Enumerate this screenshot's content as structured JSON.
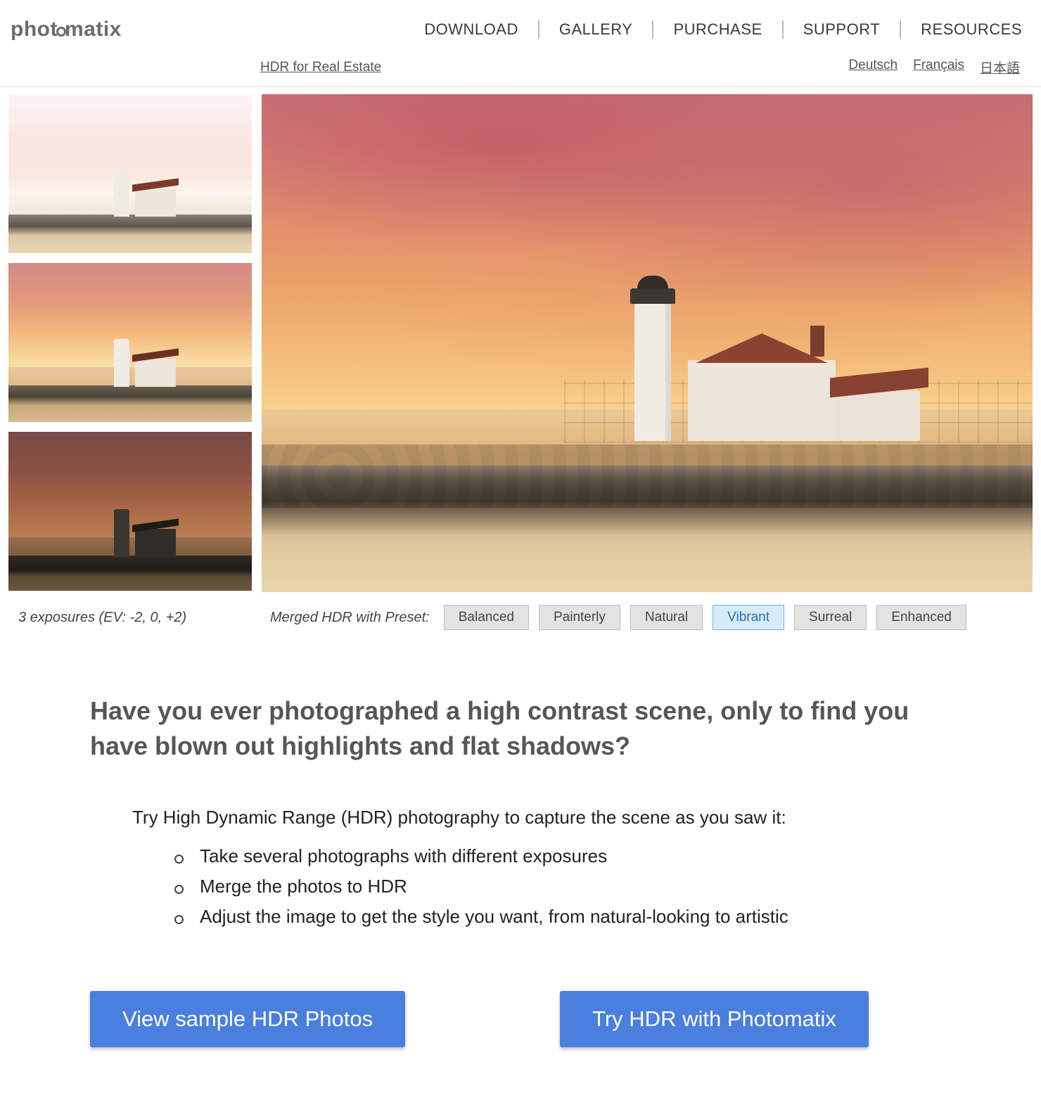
{
  "header": {
    "logo": {
      "pre": "phot",
      "post": "matix"
    },
    "nav": [
      "DOWNLOAD",
      "GALLERY",
      "PURCHASE",
      "SUPPORT",
      "RESOURCES"
    ]
  },
  "subheader": {
    "link": "HDR for Real Estate",
    "languages": [
      "Deutsch",
      "Français",
      "日本語"
    ]
  },
  "gallery": {
    "exposures_caption": "3 exposures (EV: -2, 0, +2)",
    "merged_caption": "Merged HDR with Preset:",
    "presets": [
      "Balanced",
      "Painterly",
      "Natural",
      "Vibrant",
      "Surreal",
      "Enhanced"
    ],
    "active_preset": "Vibrant"
  },
  "section": {
    "heading": "Have you ever photographed a high contrast scene, only to find you have blown out highlights and flat shadows?",
    "intro": "Try High Dynamic Range (HDR) photography to capture the scene as you saw it:",
    "steps": [
      "Take several photographs with different exposures",
      "Merge the photos to HDR",
      "Adjust the image to get the style you want, from natural-looking to artistic"
    ],
    "cta": [
      "View sample HDR Photos",
      "Try HDR with Photomatix"
    ]
  }
}
